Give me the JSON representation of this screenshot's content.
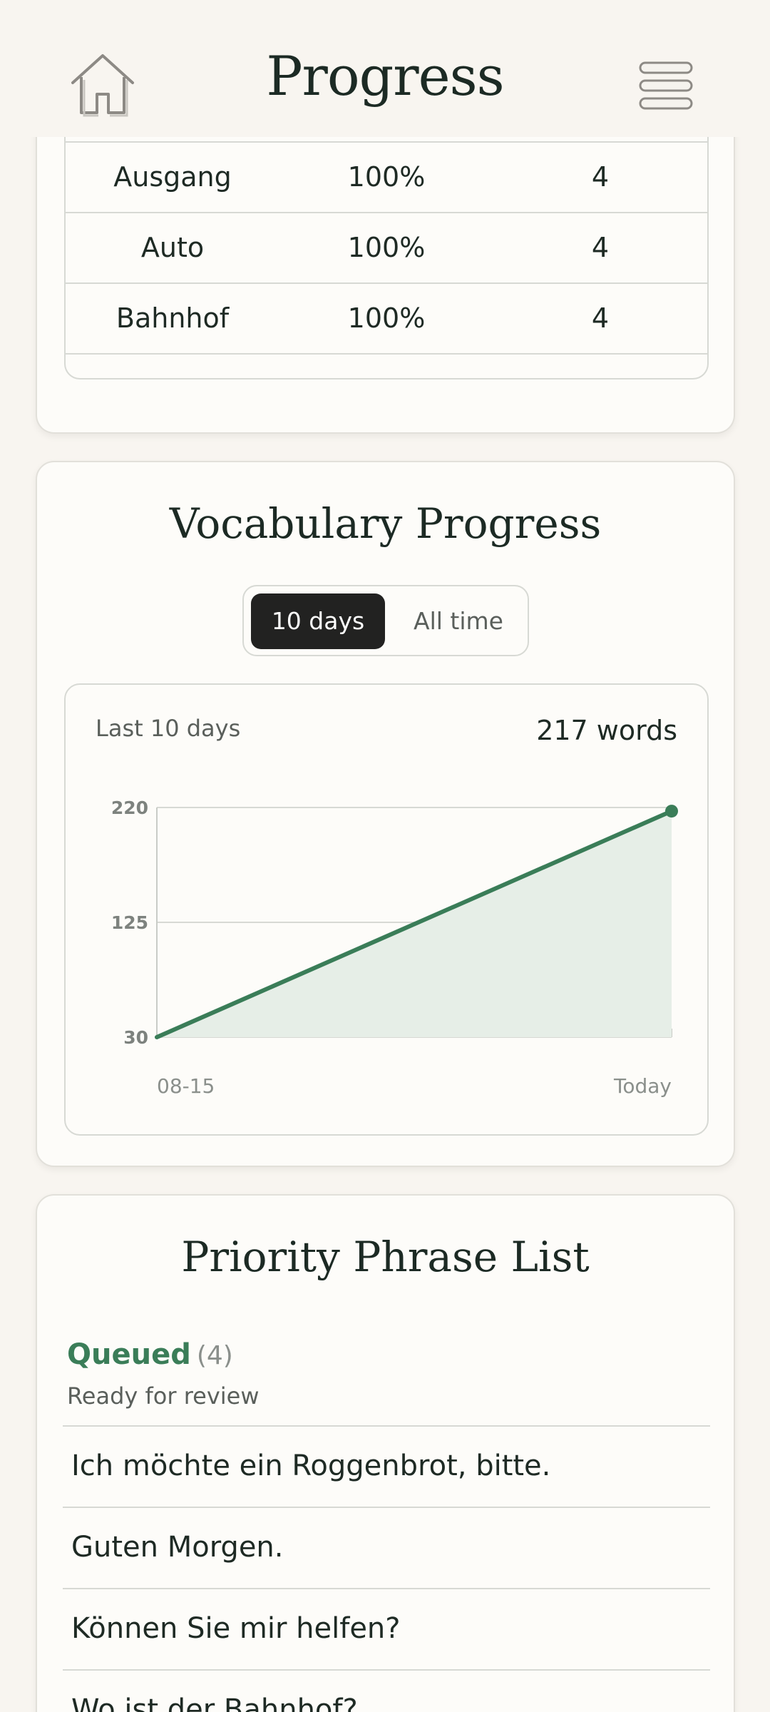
{
  "header": {
    "title": "Progress",
    "home_icon": "home-icon",
    "menu_icon": "hamburger-menu-icon"
  },
  "word_table": {
    "rows": [
      {
        "word": "Ausgang",
        "percent": "100%",
        "count": "4"
      },
      {
        "word": "Auto",
        "percent": "100%",
        "count": "4"
      },
      {
        "word": "Bahnhof",
        "percent": "100%",
        "count": "4"
      }
    ]
  },
  "vocab": {
    "title": "Vocabulary Progress",
    "toggle": {
      "active": "10 days",
      "inactive": "All time"
    },
    "range_label": "Last 10 days",
    "total_label": "217 words"
  },
  "chart_data": {
    "type": "area",
    "x": [
      "08-15",
      "Today"
    ],
    "values": [
      30,
      217
    ],
    "xtick_labels": [
      "08-15",
      "Today"
    ],
    "ytick_labels": [
      "220",
      "125",
      "30"
    ],
    "ylim": [
      30,
      220
    ],
    "yticks": [
      30,
      125,
      220
    ],
    "grid": true,
    "colors": {
      "line": "#3a7d58",
      "fill": "#e6eee7"
    }
  },
  "phrases": {
    "title": "Priority Phrase List",
    "status_label": "Queued",
    "status_count": "(4)",
    "status_sub": "Ready for review",
    "items": [
      "Ich möchte ein Roggenbrot, bitte.",
      "Guten Morgen.",
      "Können Sie mir helfen?",
      "Wo ist der Bahnhof?"
    ]
  },
  "colors": {
    "accent": "#3a7d58",
    "background": "#f8f5f0",
    "card": "#fdfcf9"
  }
}
